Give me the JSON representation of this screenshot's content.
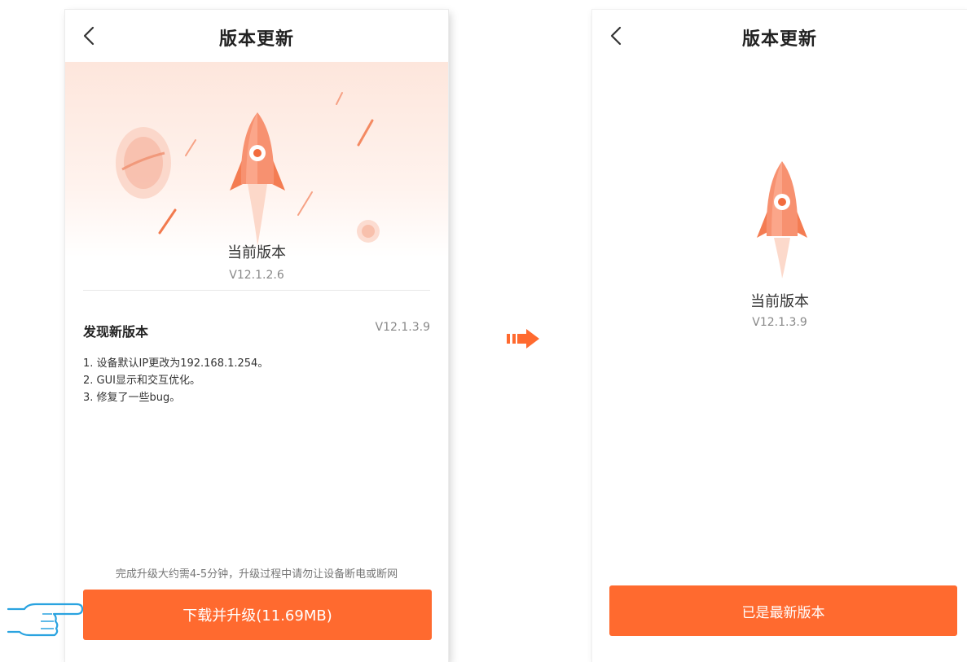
{
  "left_screen": {
    "title": "版本更新",
    "current_version_label": "当前版本",
    "current_version": "V12.1.2.6",
    "new_version_title": "发现新版本",
    "new_version": "V12.1.3.9",
    "release_notes": [
      "1. 设备默认IP更改为192.168.1.254。",
      "2. GUI显示和交互优化。",
      "3. 修复了一些bug。"
    ],
    "upgrade_tip": "完成升级大约需4-5分钟，升级过程中请勿让设备断电或断网",
    "upgrade_button": "下载并升级(11.69MB)"
  },
  "right_screen": {
    "title": "版本更新",
    "current_version_label": "当前版本",
    "current_version": "V12.1.3.9",
    "status_button": "已是最新版本"
  },
  "icons": {
    "back": "chevron-left-icon",
    "rocket": "rocket-icon",
    "planet": "planet-icon",
    "transition_arrow": "arrow-right-icon",
    "pointer_hand": "pointing-hand-icon"
  },
  "colors": {
    "accent": "#ff6a2f",
    "hero_background": "#fde6dc",
    "pointer_outline": "#2aa3e0"
  }
}
